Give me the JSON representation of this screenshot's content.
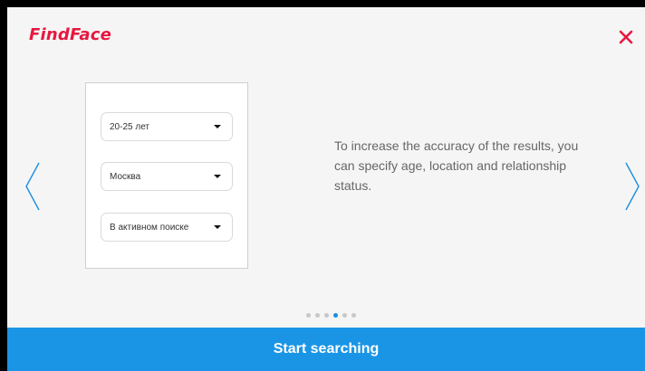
{
  "header": {
    "logo_text": "FindFace",
    "brand_color": "#e8173f",
    "close_icon": "close-icon"
  },
  "carousel": {
    "prev_icon": "chevron-left-icon",
    "next_icon": "chevron-right-icon",
    "preview": {
      "dropdowns": [
        {
          "value": "20-25 лет"
        },
        {
          "value": "Москва"
        },
        {
          "value": "В активном поиске"
        }
      ]
    },
    "description": "To increase the accuracy of the results, you can specify age, location and relationship status.",
    "pagination": {
      "total": 6,
      "active_index": 3
    }
  },
  "footer": {
    "start_label": "Start searching",
    "accent_color": "#1a95e6"
  }
}
